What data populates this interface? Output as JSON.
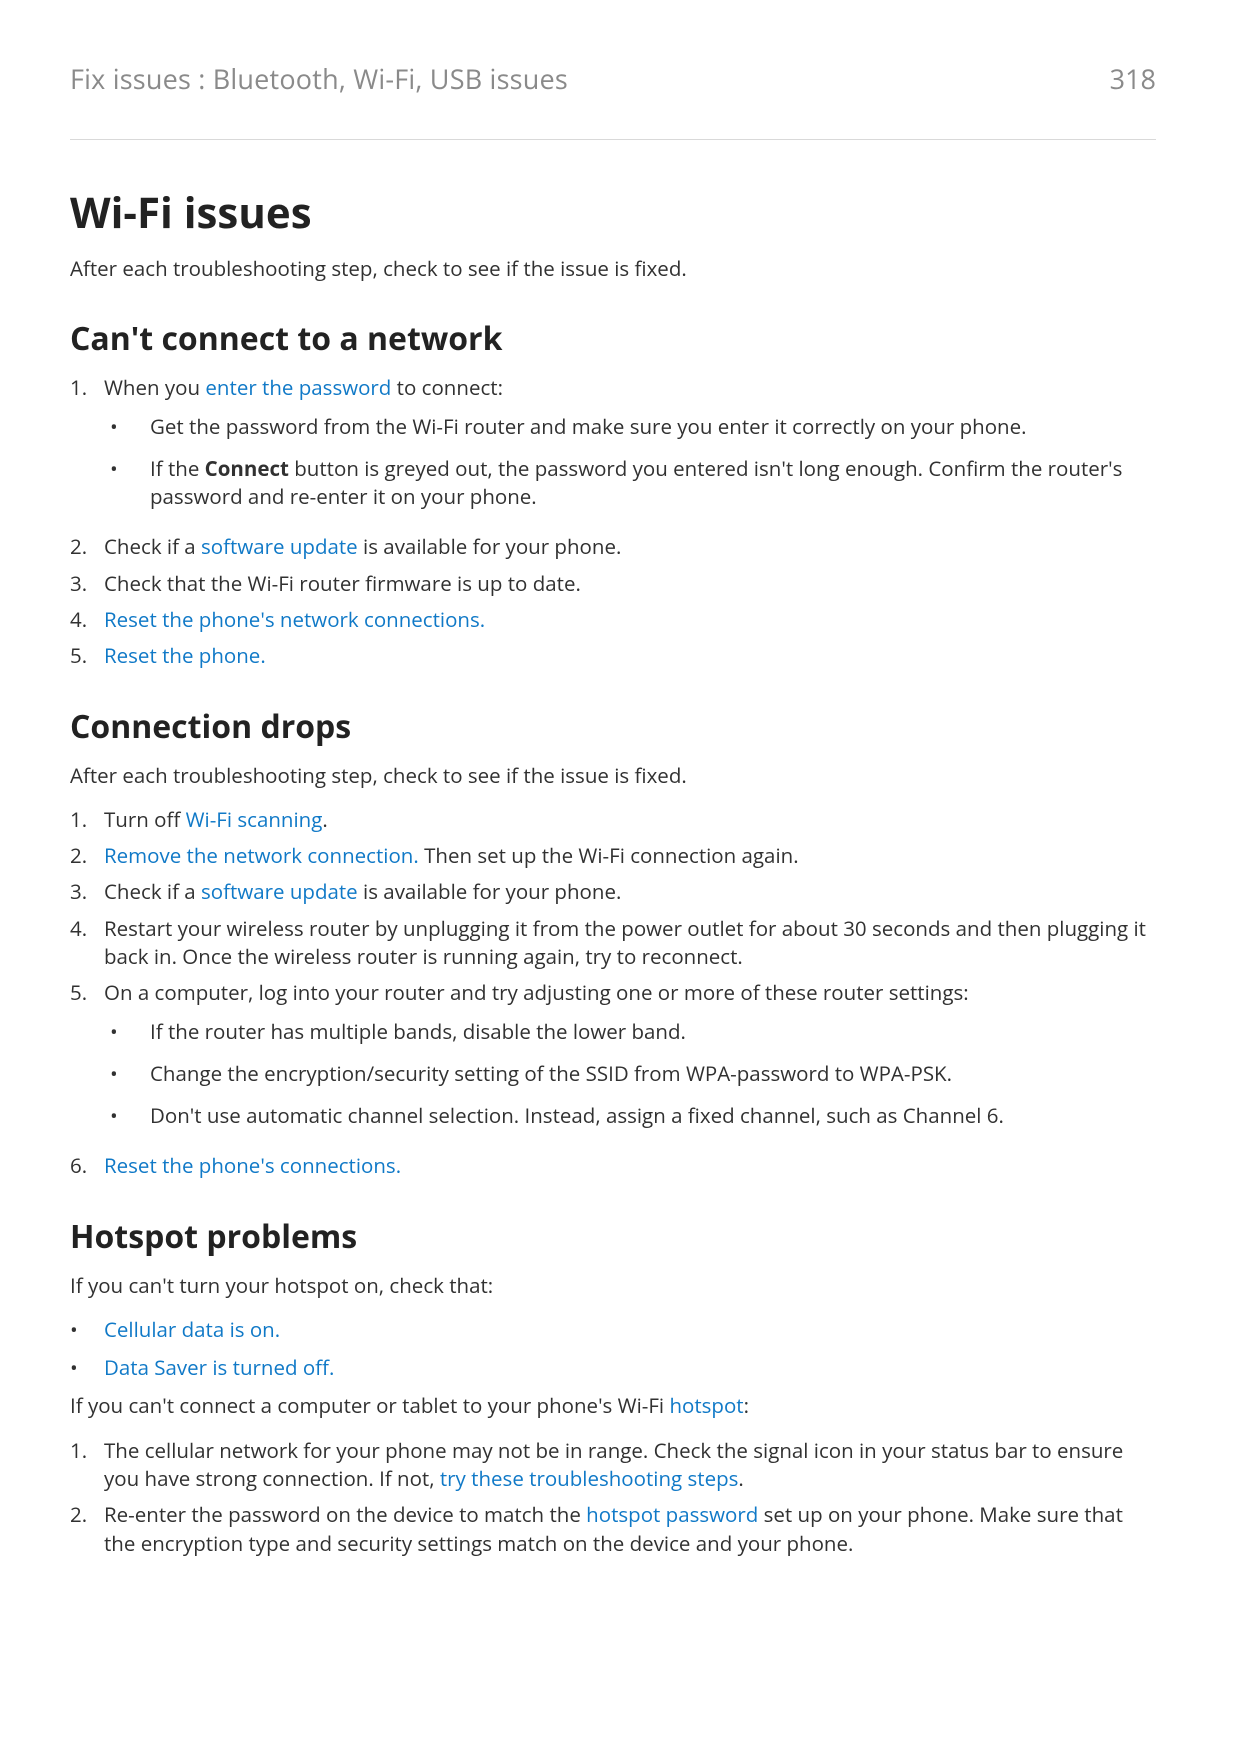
{
  "header": {
    "breadcrumb": "Fix issues : Bluetooth, Wi-Fi, USB issues",
    "page_number": "318"
  },
  "title": "Wi-Fi issues",
  "intro": "After each troubleshooting step, check to see if the issue is fixed.",
  "sec1": {
    "heading": "Can't connect to a network",
    "li1": {
      "prefix": "When you ",
      "link": "enter the password",
      "suffix": " to connect:",
      "sub1": "Get the password from the Wi-Fi router and make sure you enter it correctly on your phone.",
      "sub2_pre": "If the ",
      "sub2_bold": "Connect",
      "sub2_post": " button is greyed out, the password you entered isn't long enough. Confirm the router's password and re-enter it on your phone."
    },
    "li2": {
      "pre": "Check if a ",
      "link": "software update",
      "post": " is available for your phone."
    },
    "li3": "Check that the Wi-Fi router firmware is up to date.",
    "li4": "Reset the phone's network connections.",
    "li5": "Reset the phone."
  },
  "sec2": {
    "heading": "Connection drops",
    "intro": "After each troubleshooting step, check to see if the issue is fixed.",
    "li1": {
      "pre": "Turn off ",
      "link": "Wi-Fi scanning",
      "post": "."
    },
    "li2": {
      "link": "Remove the network connection.",
      "post": " Then set up the Wi-Fi connection again."
    },
    "li3": {
      "pre": "Check if a ",
      "link": "software update",
      "post": " is available for your phone."
    },
    "li4": "Restart your wireless router by unplugging it from the power outlet for about 30 seconds and then plugging it back in. Once the wireless router is running again, try to reconnect.",
    "li5": {
      "text": "On a computer, log into your router and try adjusting one or more of these router settings:",
      "sub1": "If the router has multiple bands, disable the lower band.",
      "sub2": "Change the encryption/security setting of the SSID from WPA-password to WPA-PSK.",
      "sub3": "Don't use automatic channel selection. Instead, assign a fixed channel, such as Channel 6."
    },
    "li6": "Reset the phone's connections."
  },
  "sec3": {
    "heading": "Hotspot problems",
    "p1": "If you can't turn your hotspot on, check that:",
    "b1": "Cellular data is on.",
    "b2": "Data Saver is turned off.",
    "p2": {
      "pre": "If you can't connect a computer or tablet to your phone's Wi-Fi ",
      "link": "hotspot",
      "post": ":"
    },
    "li1": {
      "pre": "The cellular network for your phone may not be in range. Check the signal icon in your status bar to ensure you have strong connection. If not, ",
      "link": "try these troubleshooting steps",
      "post": "."
    },
    "li2": {
      "pre": "Re-enter the password on the device to match the ",
      "link": "hotspot password",
      "post": " set up on your phone. Make sure that the encryption type and security settings match on the device and your phone."
    }
  }
}
